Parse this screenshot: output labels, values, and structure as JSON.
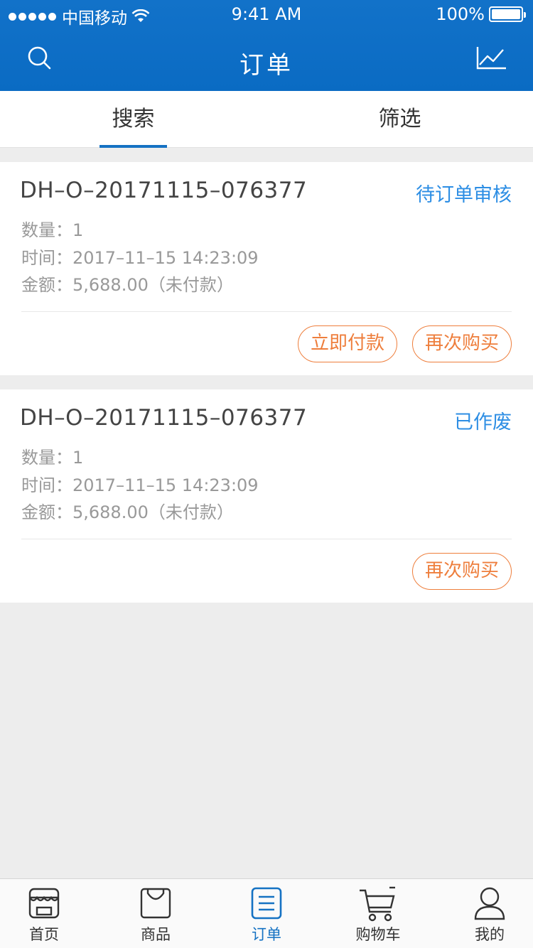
{
  "status_bar": {
    "carrier": "中国移动",
    "time": "9:41 AM",
    "battery": "100%"
  },
  "nav": {
    "title": "订单",
    "left_icon": "search-icon",
    "right_icon": "chart-icon"
  },
  "tabs": [
    {
      "label": "搜索",
      "active": true
    },
    {
      "label": "筛选",
      "active": false
    }
  ],
  "orders": [
    {
      "order_no": "DH–O–20171115–076377",
      "status": "待订单审核",
      "quantity": "数量：1",
      "time": "时间：2017–11–15   14:23:09",
      "amount": "金额：5,688.00（未付款）",
      "actions": [
        "立即付款",
        "再次购买"
      ]
    },
    {
      "order_no": "DH–O–20171115–076377",
      "status": "已作废",
      "quantity": "数量：1",
      "time": "时间：2017–11–15   14:23:09",
      "amount": "金额：5,688.00（未付款）",
      "actions": [
        "再次购买"
      ]
    }
  ],
  "tabbar": [
    {
      "label": "首页",
      "icon": "store-icon",
      "active": false
    },
    {
      "label": "商品",
      "icon": "bag-icon",
      "active": false
    },
    {
      "label": "订单",
      "icon": "list-icon",
      "active": true
    },
    {
      "label": "购物车",
      "icon": "cart-icon",
      "active": false
    },
    {
      "label": "我的",
      "icon": "user-icon",
      "active": false
    }
  ],
  "colors": {
    "primary": "#1272c9",
    "status_text": "#2d8ee4",
    "action": "#ee7e3c"
  }
}
